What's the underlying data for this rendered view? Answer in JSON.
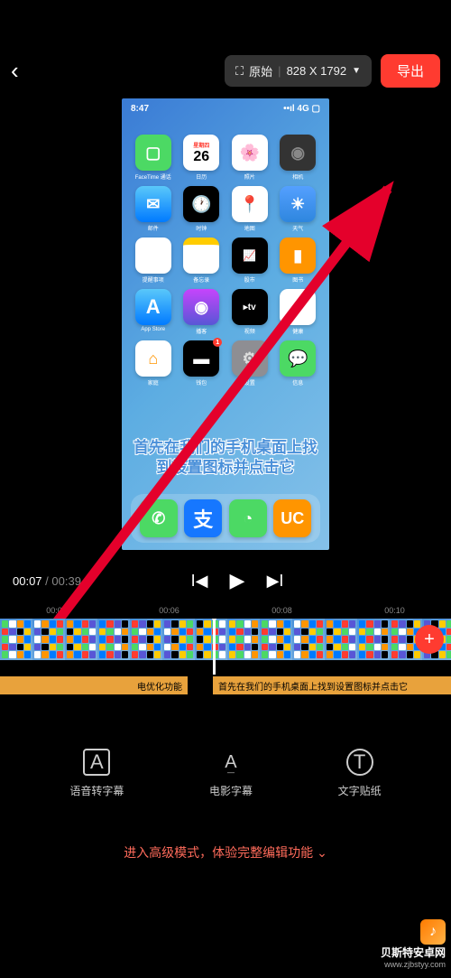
{
  "header": {
    "aspect_label": "原始",
    "resolution": "828 X 1792",
    "export_label": "导出"
  },
  "preview": {
    "phone_time": "8:47",
    "phone_signal": "4G",
    "subtitle": "首先在我们的手机桌面上找到设置图标并点击它",
    "apps": {
      "r1": [
        "FaceTime 通话",
        "日历",
        "照片",
        "相机"
      ],
      "r2": [
        "邮件",
        "时钟",
        "地图",
        "天气"
      ],
      "r3": [
        "提醒事项",
        "备忘录",
        "股市",
        "图书"
      ],
      "r4": [
        "App Store",
        "播客",
        "视频",
        "健康"
      ],
      "r5": [
        "家庭",
        "钱包",
        "设置",
        "信息"
      ]
    },
    "calendar_day": "26",
    "calendar_weekday": "星期四"
  },
  "transport": {
    "current": "00:07",
    "total": "00:39"
  },
  "ruler": [
    "00:04",
    "00:06",
    "00:08",
    "00:10"
  ],
  "subtitle_track": {
    "clip1": "电优化功能",
    "clip2": "首先在我们的手机桌面上找到设置图标并点击它"
  },
  "tools": {
    "voice_sub": "语音转字幕",
    "movie_sub": "电影字幕",
    "text_sticker": "文字贴纸"
  },
  "advanced": "进入高级模式，体验完整编辑功能",
  "watermark": {
    "cn": "贝斯特安卓网",
    "url": "www.zjbstyy.com"
  }
}
